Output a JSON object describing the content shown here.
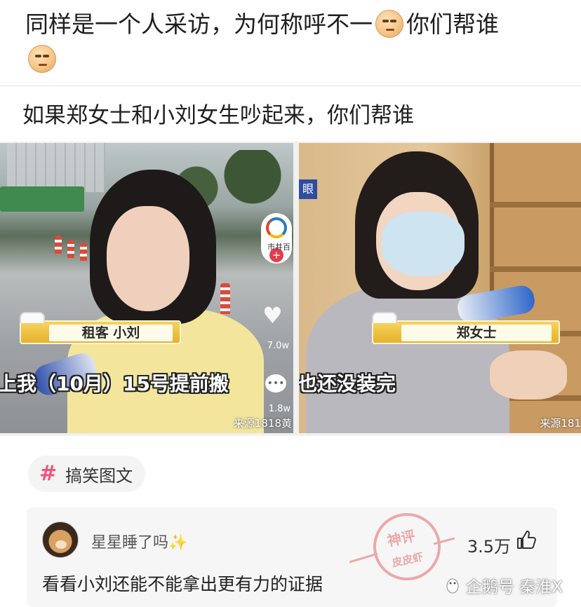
{
  "post": {
    "title": "同样是一个人采访，为何称呼不一",
    "title_tail": "你们帮谁"
  },
  "card": {
    "caption": "如果郑女士和小刘女生吵起来，你们帮谁",
    "left_photo": {
      "nametag": "租客 小刘",
      "subtitle": "上我（10月）15号提前搬",
      "logo_text": "市井百",
      "like_count": "7.0w",
      "share_count": "1.8w",
      "source": "来源1818黄"
    },
    "right_photo": {
      "eye_badge": "眼",
      "nametag": "郑女士",
      "subtitle": "也还没装完",
      "source": "来源181"
    }
  },
  "topic": {
    "label": "搞笑图文"
  },
  "comment": {
    "username": "星星睡了吗",
    "sparkle": "✨",
    "likes": "3.5万",
    "text": "看看小刘还能不能拿出更有力的证据"
  },
  "watermark": {
    "seal_top": "神评",
    "seal_bottom": "皮皮虾"
  },
  "footer": {
    "brand": "企鹅号 秦淮X"
  },
  "colors": {
    "topic_hash": "#f0557a",
    "nametag_gold": "#e5b22e",
    "watermark_red": "#e46a6a"
  },
  "icons": [
    "smirk-emoji-icon",
    "hashtag-icon",
    "thumbs-up-icon",
    "heart-icon",
    "comment-icon",
    "penguin-icon"
  ]
}
